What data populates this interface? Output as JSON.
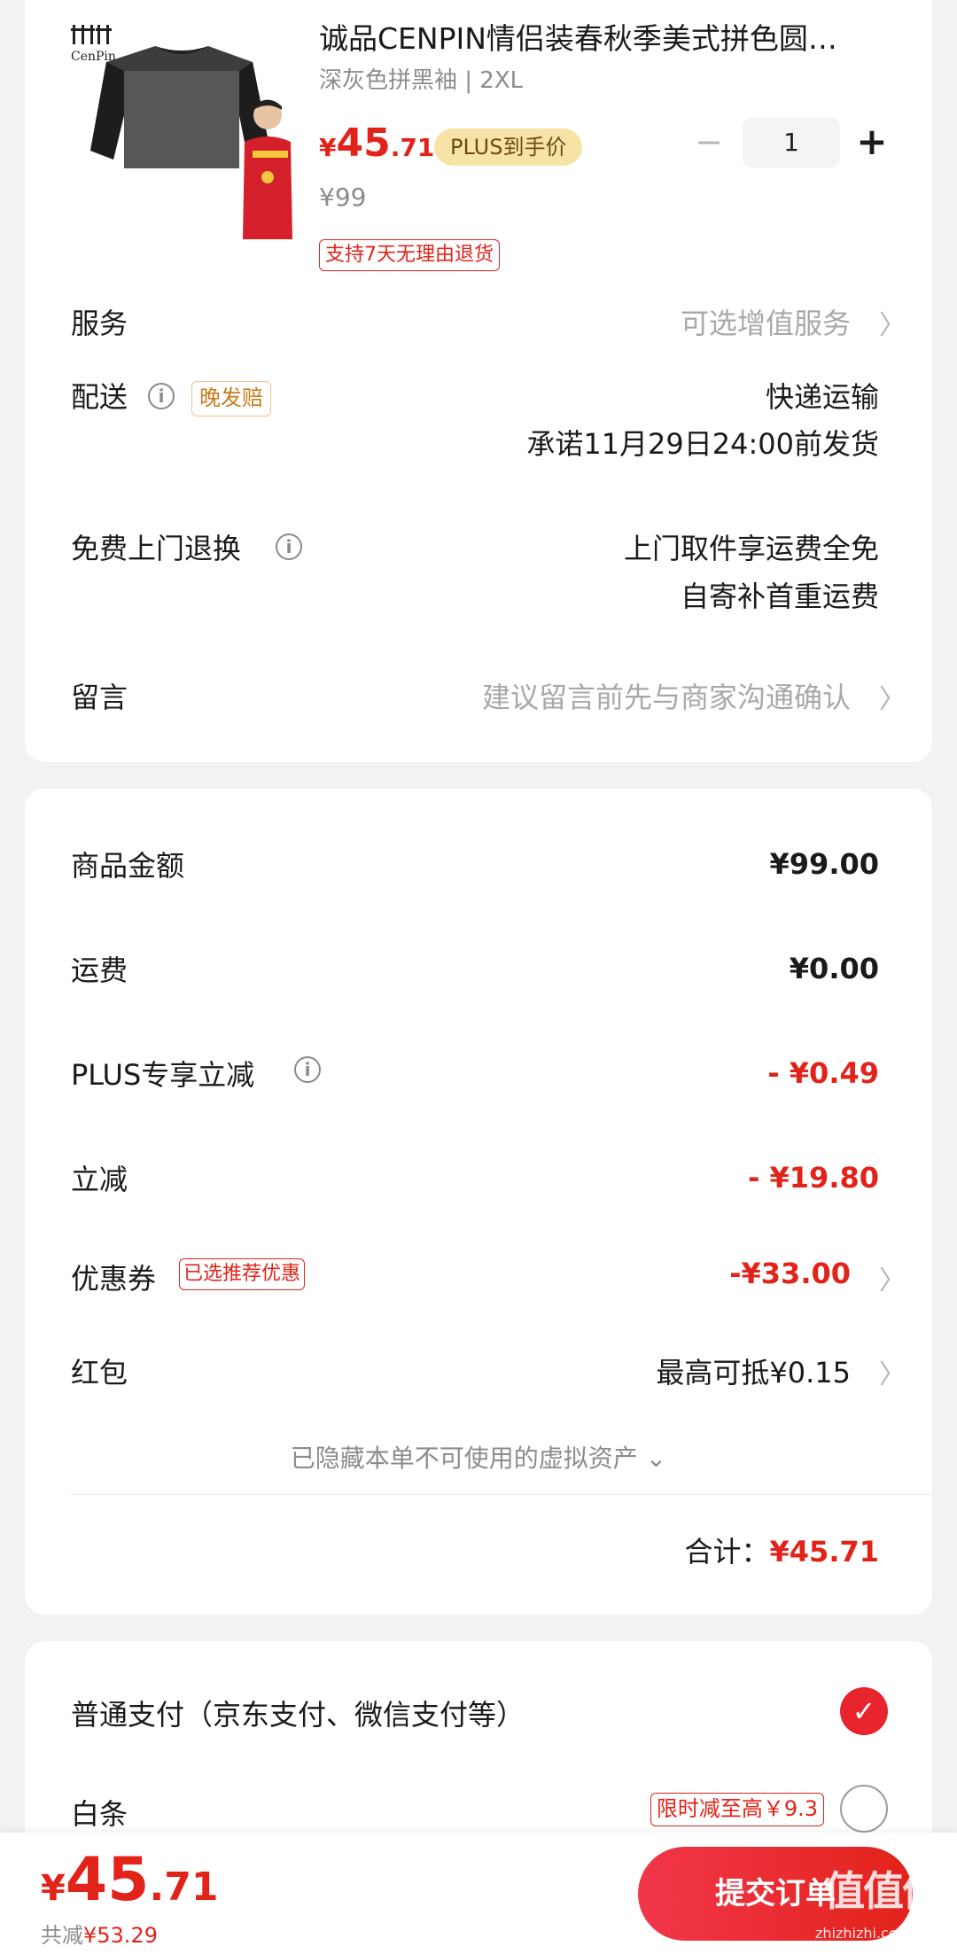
{
  "product": {
    "brand_logo_text": "CenPin",
    "title": "诚品CENPIN情侣装春秋季美式拼色圆…",
    "spec": "深灰色拼黑袖 | 2XL",
    "price_symbol": "¥",
    "price_int": "45",
    "price_dec": ".71",
    "plus_badge": "PLUS到手价",
    "original_price": "¥99",
    "return_tag": "支持7天无理由退货",
    "quantity": "1",
    "minus": "−",
    "plus": "+"
  },
  "options": {
    "service_label": "服务",
    "service_value": "可选增值服务",
    "delivery_label": "配送",
    "late_tag": "晚发赔",
    "delivery_method": "快递运输",
    "delivery_promise": "承诺11月29日24:00前发货",
    "return_label": "免费上门退换",
    "return_line1": "上门取件享运费全免",
    "return_line2": "自寄补首重运费",
    "message_label": "留言",
    "message_placeholder": "建议留言前先与商家沟通确认"
  },
  "summary": {
    "goods_label": "商品金额",
    "goods_value": "¥99.00",
    "shipping_label": "运费",
    "shipping_value": "¥0.00",
    "plus_label": "PLUS专享立减",
    "plus_value": "- ¥0.49",
    "discount_label": "立减",
    "discount_value": "- ¥19.80",
    "coupon_label": "优惠券",
    "coupon_tag": "已选推荐优惠",
    "coupon_value": "-¥33.00",
    "redpacket_label": "红包",
    "redpacket_value": "最高可抵¥0.15",
    "hidden_assets": "已隐藏本单不可使用的虚拟资产",
    "total_label": "合计：",
    "total_value": "¥45.71"
  },
  "payment": {
    "normal_label": "普通支付（京东支付、微信支付等）",
    "baitiao_label": "白条",
    "baitiao_tag": "限时减至高￥9.3"
  },
  "bottom": {
    "price_symbol": "¥",
    "price_int": "45",
    "price_dec": ".71",
    "saved_label": "共减",
    "saved_value": "¥53.29",
    "submit": "提交订单",
    "watermark": "值值值",
    "watermark_url": "zhizhizhi.com"
  },
  "colors": {
    "accent": "#e2231a",
    "plus_badge_bg": "#f6e3a8",
    "late_tag": "#c97a1a"
  }
}
